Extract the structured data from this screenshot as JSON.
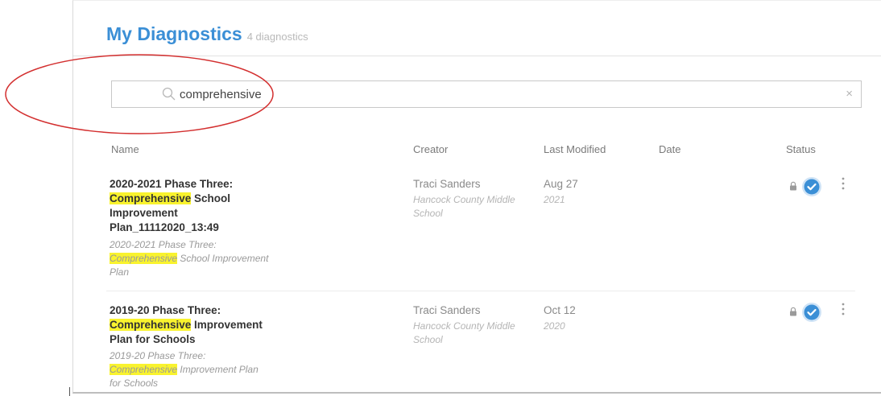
{
  "header": {
    "title": "My Diagnostics",
    "count": "4 diagnostics"
  },
  "search": {
    "value": "comprehensive",
    "placeholder": "",
    "clear_glyph": "×"
  },
  "columns": {
    "name": "Name",
    "creator": "Creator",
    "last_modified": "Last Modified",
    "date": "Date",
    "status": "Status"
  },
  "rows": [
    {
      "title_pre": "2020-2021 Phase Three: ",
      "title_hl": "Comprehensive",
      "title_post": " School Improvement Plan_11112020_13:49",
      "sub_pre": "2020-2021 Phase Three: ",
      "sub_hl": "Comprehensive",
      "sub_post": " School Improvement Plan",
      "creator": "Traci Sanders",
      "org": "Hancock County Middle School",
      "modified": "Aug 27",
      "year": "2021",
      "date": "",
      "status_icons": [
        "lock-icon",
        "check-circle-icon",
        "more-vertical-icon"
      ]
    },
    {
      "title_pre": "2019-20 Phase Three: ",
      "title_hl": "Comprehensive",
      "title_post": " Improvement Plan for Schools",
      "sub_pre": "2019-20 Phase Three: ",
      "sub_hl": "Comprehensive",
      "sub_post": " Improvement Plan for Schools",
      "creator": "Traci Sanders",
      "org": "Hancock County Middle School",
      "modified": "Oct 12",
      "year": "2020",
      "date": "",
      "status_icons": [
        "lock-icon",
        "check-circle-icon",
        "more-vertical-icon"
      ]
    }
  ],
  "colors": {
    "accent": "#3b8fd6",
    "highlight": "#f9f32e",
    "annotation": "#d32f2f"
  }
}
